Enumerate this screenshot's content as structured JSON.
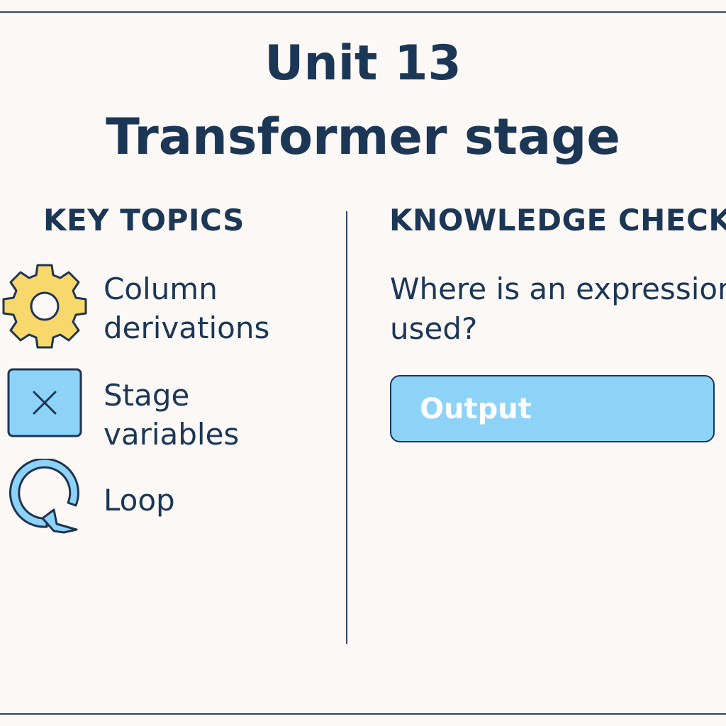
{
  "header": {
    "title_line1": "Unit 13",
    "title_line2": "Transformer stage"
  },
  "key_topics": {
    "heading": "KEY TOPICS",
    "items": [
      {
        "icon": "gear-icon",
        "line1": "Column",
        "line2": "derivations"
      },
      {
        "icon": "x-box-icon",
        "line1": "Stage",
        "line2": "variables"
      },
      {
        "icon": "loop-arrow-icon",
        "line1": "Loop"
      }
    ]
  },
  "knowledge_check": {
    "heading": "KNOWLEDGE CHECK",
    "question": "Where is an expression used?",
    "answer_label": "Output"
  },
  "colors": {
    "background": "#fbf8f5",
    "text": "#1c3756",
    "gear": "#f8d76b",
    "accent_blue": "#8dd3f8"
  }
}
